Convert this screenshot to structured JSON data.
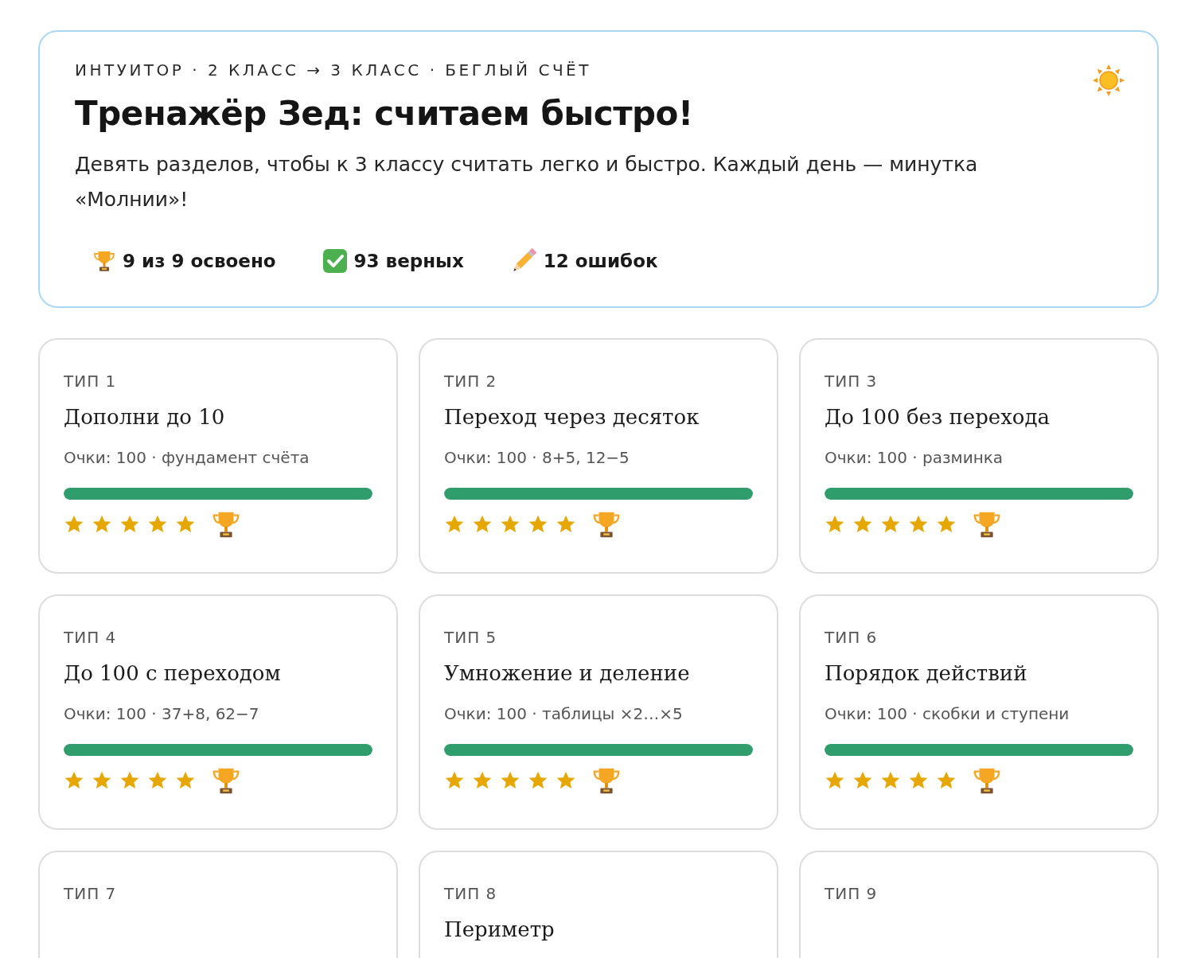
{
  "header": {
    "breadcrumb": "ИНТУИТОР · 2 КЛАСС → 3 КЛАСС · БЕГЛЫЙ СЧЁТ",
    "title": "Тренажёр Зед: считаем быстро!",
    "description": "Девять разделов, чтобы к 3 классу считать легко и быстро. Каждый день — минутка «Молнии»!",
    "stats": [
      {
        "kind": "trophy",
        "text": "9 из 9 освоено"
      },
      {
        "kind": "check",
        "text": "93 верных"
      },
      {
        "kind": "pencil",
        "text": "12 ошибок"
      }
    ]
  },
  "sections": [
    {
      "label": "ТИП 1",
      "title": "Дополни до 10",
      "meta": "Очки: 100 · фундамент счёта",
      "level": 1,
      "stars": 5,
      "mastered": true
    },
    {
      "label": "ТИП 2",
      "title": "Переход через десяток",
      "meta": "Очки: 100 · 8+5, 12−5",
      "level": 1,
      "stars": 5,
      "mastered": true
    },
    {
      "label": "ТИП 3",
      "title": "До 100 без перехода",
      "meta": "Очки: 100 · разминка",
      "level": 1,
      "stars": 5,
      "mastered": true
    },
    {
      "label": "ТИП 4",
      "title": "До 100 с переходом",
      "meta": "Очки: 100 · 37+8, 62−7",
      "level": 1,
      "stars": 5,
      "mastered": true
    },
    {
      "label": "ТИП 5",
      "title": "Умножение и деление",
      "meta": "Очки: 100 · таблицы ×2…×5",
      "level": 1,
      "stars": 5,
      "mastered": true
    },
    {
      "label": "ТИП 6",
      "title": "Порядок действий",
      "meta": "Очки: 100 · скобки и ступени",
      "level": 1,
      "stars": 5,
      "mastered": true
    },
    {
      "label": "ТИП 7"
    },
    {
      "label": "ТИП 8",
      "title": "Периметр"
    },
    {
      "label": "ТИП 9"
    }
  ]
}
